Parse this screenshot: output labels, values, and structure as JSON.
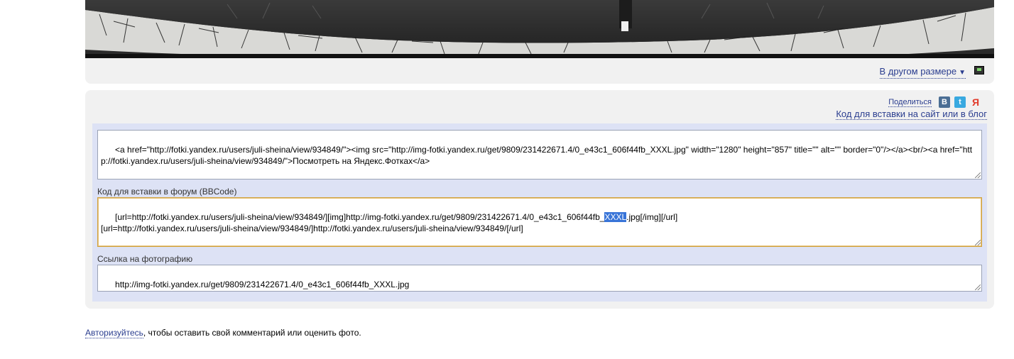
{
  "size_bar": {
    "other_size_label": "В другом размере",
    "arrow": "▼"
  },
  "share": {
    "label": "Поделиться",
    "icons": [
      "vk-icon",
      "twitter-icon",
      "yandex-icon"
    ],
    "vk_glyph": "B",
    "tw_glyph": "t",
    "ya_glyph": "Я"
  },
  "embed": {
    "site_link": "Код для вставки на сайт или в блог",
    "html_code": "<a href=\"http://fotki.yandex.ru/users/juli-sheina/view/934849/\"><img src=\"http://img-fotki.yandex.ru/get/9809/231422671.4/0_e43c1_606f44fb_XXXL.jpg\" width=\"1280\" height=\"857\" title=\"\" alt=\"\" border=\"0\"/></a><br/><a href=\"http://fotki.yandex.ru/users/juli-sheina/view/934849/\">Посмотреть на Яндекс.Фотках</a>",
    "forum_label": "Код для вставки в форум (BBCode)",
    "forum_before_sel": "[url=http://fotki.yandex.ru/users/juli-sheina/view/934849/][img]http://img-fotki.yandex.ru/get/9809/231422671.4/0_e43c1_606f44fb_",
    "forum_sel": "XXXL",
    "forum_after_sel": ".jpg[/img][/url]\n[url=http://fotki.yandex.ru/users/juli-sheina/view/934849/]http://fotki.yandex.ru/users/juli-sheina/view/934849/[/url]",
    "link_label": "Ссылка на фотографию",
    "link_value": "http://img-fotki.yandex.ru/get/9809/231422671.4/0_e43c1_606f44fb_XXXL.jpg"
  },
  "auth": {
    "link": "Авторизуйтесь",
    "rest": ", чтобы оставить свой комментарий или оценить фото."
  }
}
